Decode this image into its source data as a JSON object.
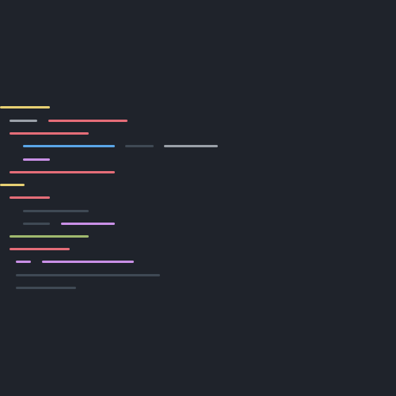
{
  "editor": {
    "background": "#1f232b",
    "palette": {
      "yellow": "#e6cf73",
      "red": "#e46d78",
      "blue": "#5aa5e6",
      "purple": "#c990e6",
      "green": "#9fb86e",
      "gray": "#9aa0a8",
      "dim": "#3f4954",
      "dark": "#2f3942"
    },
    "lines": [
      {
        "name": "code-line-1",
        "segments": [
          {
            "color": "yellow"
          }
        ]
      },
      {
        "name": "code-line-2",
        "segments": [
          {
            "color": "gray"
          },
          {
            "color": "red"
          }
        ]
      },
      {
        "name": "code-line-3",
        "segments": [
          {
            "color": "red"
          }
        ]
      },
      {
        "name": "code-line-4",
        "segments": [
          {
            "color": "blue"
          },
          {
            "color": "dim"
          },
          {
            "color": "gray"
          }
        ]
      },
      {
        "name": "code-line-5",
        "segments": [
          {
            "color": "purple"
          }
        ]
      },
      {
        "name": "code-line-6",
        "segments": [
          {
            "color": "red"
          }
        ]
      },
      {
        "name": "code-line-7",
        "segments": [
          {
            "color": "yellow"
          }
        ]
      },
      {
        "name": "code-line-8",
        "segments": [
          {
            "color": "red"
          }
        ]
      },
      {
        "name": "code-line-9",
        "segments": [
          {
            "color": "dim"
          }
        ]
      },
      {
        "name": "code-line-10",
        "segments": [
          {
            "color": "dim"
          },
          {
            "color": "purple"
          }
        ]
      },
      {
        "name": "code-line-11",
        "segments": [
          {
            "color": "green"
          }
        ]
      },
      {
        "name": "code-line-12",
        "segments": [
          {
            "color": "red"
          }
        ]
      },
      {
        "name": "code-line-13",
        "segments": [
          {
            "color": "purple"
          },
          {
            "color": "purple"
          }
        ]
      },
      {
        "name": "code-line-14",
        "segments": [
          {
            "color": "dim"
          }
        ]
      },
      {
        "name": "code-line-15",
        "segments": [
          {
            "color": "dim"
          }
        ]
      }
    ]
  }
}
